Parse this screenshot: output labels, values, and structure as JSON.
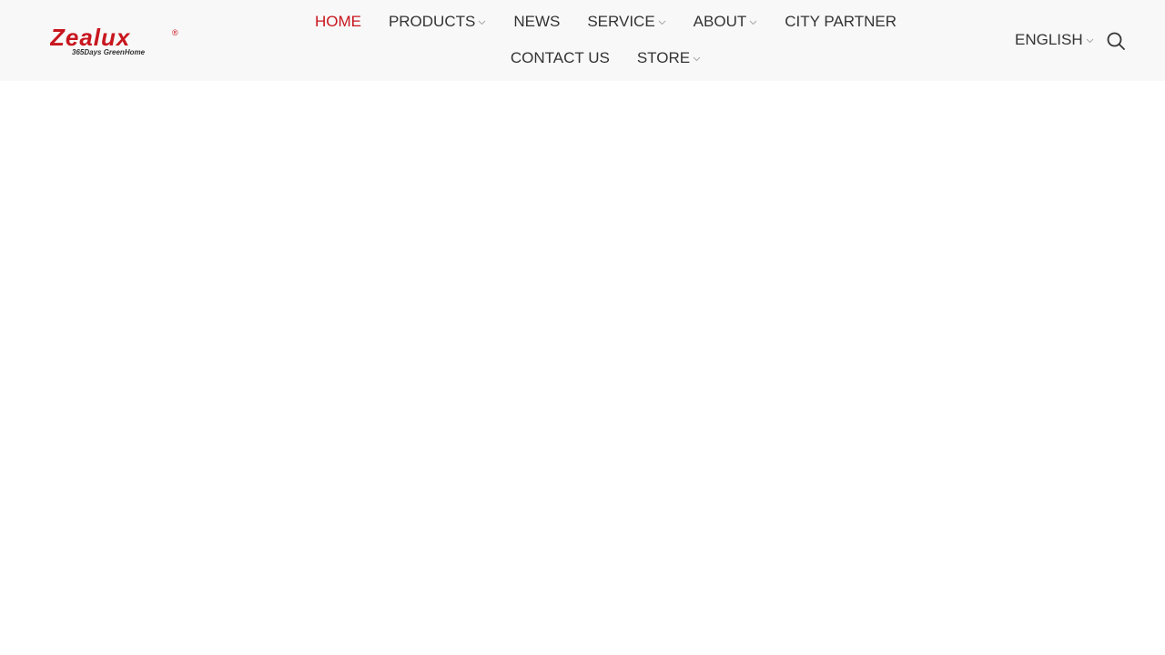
{
  "brand": {
    "name": "Zealux",
    "tagline": "365Days GreenHome",
    "registered_mark": "®",
    "color": "#c8161e"
  },
  "nav": {
    "items": [
      {
        "label": "HOME",
        "active": true,
        "has_dropdown": false
      },
      {
        "label": "PRODUCTS",
        "active": false,
        "has_dropdown": true
      },
      {
        "label": "NEWS",
        "active": false,
        "has_dropdown": false
      },
      {
        "label": "SERVICE",
        "active": false,
        "has_dropdown": true
      },
      {
        "label": "ABOUT",
        "active": false,
        "has_dropdown": true
      },
      {
        "label": "CITY PARTNER",
        "active": false,
        "has_dropdown": false
      },
      {
        "label": "CONTACT US",
        "active": false,
        "has_dropdown": false
      },
      {
        "label": "STORE",
        "active": false,
        "has_dropdown": true
      }
    ],
    "active_color": "#c8161e",
    "text_color": "#333333"
  },
  "language": {
    "selected": "ENGLISH",
    "icon": "chevron-down-icon"
  },
  "search": {
    "icon": "search-icon"
  },
  "colors": {
    "header_bg": "#f8f8f8",
    "page_bg": "#ffffff"
  }
}
